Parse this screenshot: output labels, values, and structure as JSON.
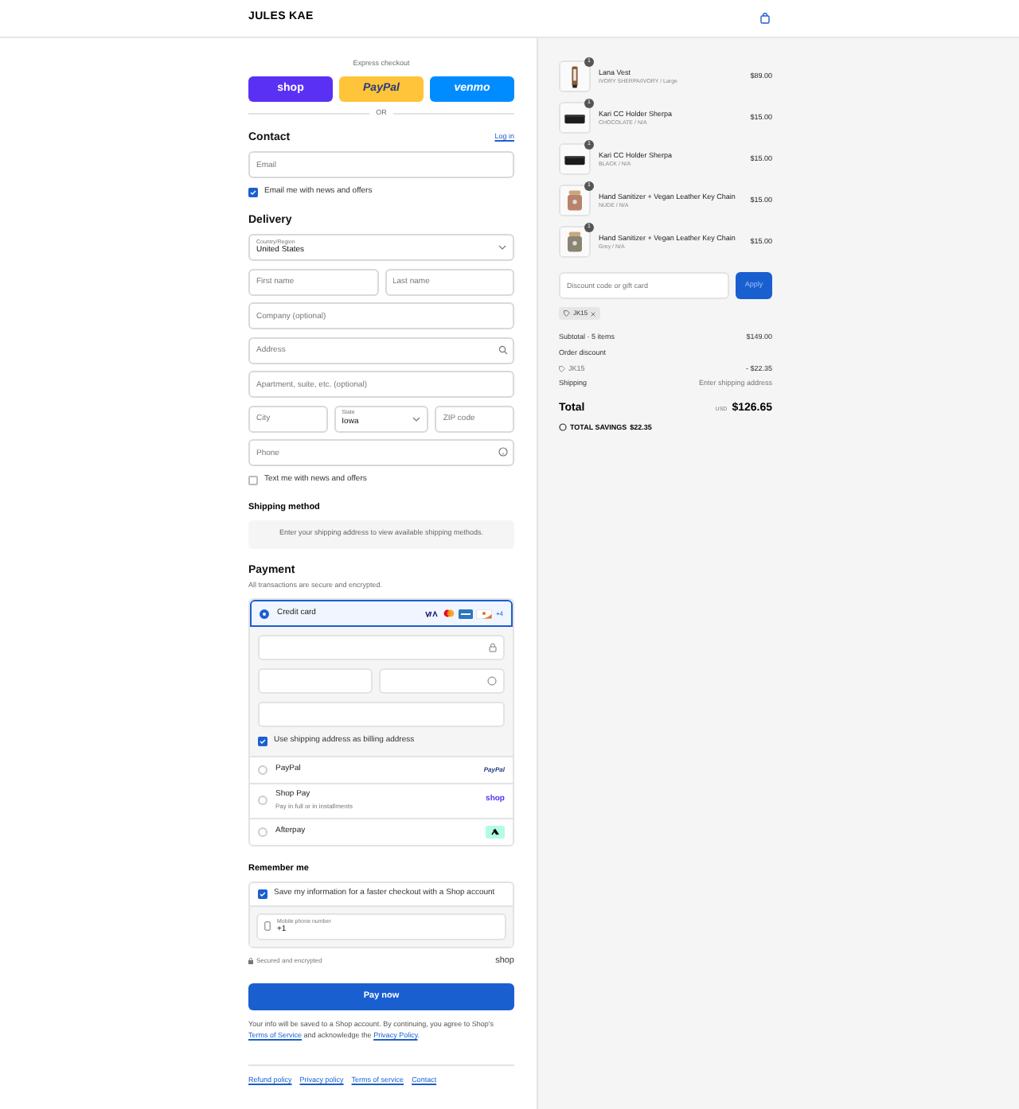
{
  "header": {
    "brand": "JULES KAE"
  },
  "express": {
    "label": "Express checkout",
    "buttons": [
      {
        "label": "shop",
        "kind": "shop"
      },
      {
        "label": "PayPal",
        "kind": "paypal"
      },
      {
        "label": "venmo",
        "kind": "venmo"
      }
    ],
    "or_label": "OR"
  },
  "contact": {
    "title": "Contact",
    "login_link": "Log in",
    "email": {
      "placeholder": "Email"
    },
    "news": {
      "label": "Email me with news and offers",
      "checked": true
    }
  },
  "delivery": {
    "title": "Delivery",
    "rows": [
      [
        {
          "kind": "select",
          "label": "Country/Region",
          "value": "United States"
        }
      ],
      [
        {
          "kind": "text",
          "placeholder": "First name"
        },
        {
          "kind": "text",
          "placeholder": "Last name"
        }
      ],
      [
        {
          "kind": "text",
          "placeholder": "Company (optional)"
        }
      ],
      [
        {
          "kind": "search",
          "placeholder": "Address"
        }
      ],
      [
        {
          "kind": "text",
          "placeholder": "Apartment, suite, etc. (optional)"
        }
      ],
      [
        {
          "kind": "text",
          "placeholder": "City"
        },
        {
          "kind": "select",
          "label": "State",
          "value": "Iowa"
        },
        {
          "kind": "text",
          "placeholder": "ZIP code"
        }
      ],
      [
        {
          "kind": "help",
          "placeholder": "Phone"
        }
      ]
    ],
    "sms": {
      "label": "Text me with news and offers",
      "checked": false
    }
  },
  "shipping_method": {
    "title": "Shipping method",
    "message": "Enter your shipping address to view available shipping methods."
  },
  "payment": {
    "title": "Payment",
    "subtitle": "All transactions are secure and encrypted.",
    "methods": [
      {
        "kind": "card",
        "label": "Credit card",
        "selected": true,
        "more": "+4"
      },
      {
        "kind": "paypal",
        "label": "PayPal",
        "selected": false,
        "logo": "PayPal"
      },
      {
        "kind": "shoppay",
        "label": "Shop Pay",
        "sublabel": "Pay in full or in installments",
        "selected": false,
        "logo": "shop"
      },
      {
        "kind": "afterpay",
        "label": "Afterpay",
        "selected": false
      }
    ],
    "billing": {
      "label": "Use shipping address as billing address",
      "checked": true
    }
  },
  "remember": {
    "title": "Remember me",
    "save": {
      "label": "Save my information for a faster checkout with a Shop account",
      "checked": true
    },
    "phone": {
      "label": "Mobile phone number",
      "value": "+1"
    },
    "secure": "Secured and encrypted",
    "shop_logo": "shop"
  },
  "pay_button": "Pay now",
  "legal": {
    "text1": "Your info will be saved to a Shop account. By continuing, you agree to Shop's ",
    "link1": "Terms of Service",
    "text2": " and acknowledge the ",
    "link2": "Privacy Policy",
    "text3": "."
  },
  "footer_links": [
    "Refund policy",
    "Privacy policy",
    "Terms of service",
    "Contact"
  ],
  "order": {
    "items": [
      {
        "name": "Lana Vest",
        "variant": "IVORY SHERPA/IVORY / Large",
        "price": "$89.00",
        "quantity": "1"
      },
      {
        "name": "Kari CC Holder Sherpa",
        "variant": "CHOCOLATE / N/A",
        "price": "$15.00",
        "quantity": "1"
      },
      {
        "name": "Kari CC Holder Sherpa",
        "variant": "BLACK / N/A",
        "price": "$15.00",
        "quantity": "1"
      },
      {
        "name": "Hand Sanitizer + Vegan Leather Key Chain",
        "variant": "NUDE / N/A",
        "price": "$15.00",
        "quantity": "1"
      },
      {
        "name": "Hand Sanitizer + Vegan Leather Key Chain",
        "variant": "Grey / N/A",
        "price": "$15.00",
        "quantity": "1"
      }
    ],
    "discount": {
      "placeholder": "Discount code or gift card",
      "button": "Apply"
    },
    "codes": [
      "JK15"
    ],
    "subtotal": {
      "label": "Subtotal · 5 items",
      "value": "$149.00"
    },
    "order_discount": {
      "label": "Order discount",
      "code": "JK15",
      "value": "- $22.35"
    },
    "shipping": {
      "label": "Shipping",
      "value": "Enter shipping address"
    },
    "total": {
      "label": "Total",
      "currency": "USD",
      "value": "$126.65"
    },
    "savings": {
      "label": "TOTAL SAVINGS",
      "value": "$22.35"
    }
  }
}
